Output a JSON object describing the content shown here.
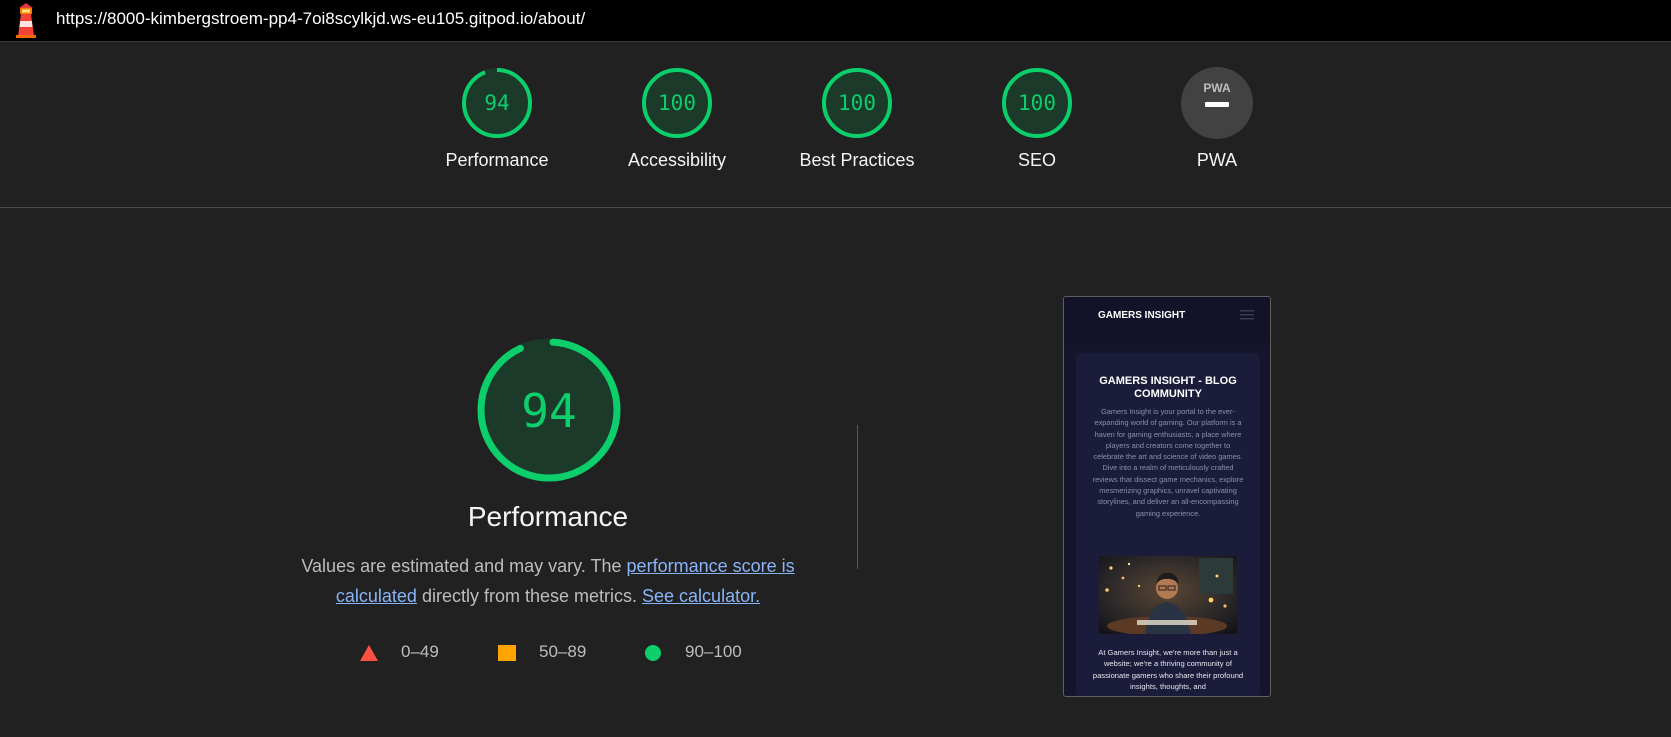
{
  "address_bar": {
    "icon": "lighthouse-icon",
    "url": "https://8000-kimbergstroem-pp4-7oi8scylkjd.ws-eu105.gitpod.io/about/"
  },
  "colors": {
    "pass": "#0cce6b",
    "pass_bg": "#1b3a2a",
    "average": "#ffa400",
    "fail": "#ff4e42",
    "pwa_bg": "#424242",
    "link": "#8ab4f8"
  },
  "gauges": [
    {
      "label": "Performance",
      "score": "94",
      "value": 94
    },
    {
      "label": "Accessibility",
      "score": "100",
      "value": 100
    },
    {
      "label": "Best Practices",
      "score": "100",
      "value": 100
    },
    {
      "label": "SEO",
      "score": "100",
      "value": 100
    },
    {
      "label": "PWA",
      "score": "",
      "badge": "PWA"
    }
  ],
  "performance": {
    "score": "94",
    "value": 94,
    "title": "Performance",
    "desc_prefix": "Values are estimated and may vary. The ",
    "desc_link1": "performance score is calculated",
    "desc_middle": " directly from these metrics. ",
    "desc_link2": "See calculator."
  },
  "legend": [
    {
      "shape": "triangle",
      "range": "0–49"
    },
    {
      "shape": "square",
      "range": "50–89"
    },
    {
      "shape": "circle",
      "range": "90–100"
    }
  ],
  "screenshot": {
    "brand": "GAMERS INSIGHT",
    "title": "GAMERS INSIGHT - BLOG COMMUNITY",
    "body": "Gamers Insight is your portal to the ever-expanding world of gaming. Our platform is a haven for gaming enthusiasts, a place where players and creators come together to celebrate the art and science of video games. Dive into a realm of meticulously crafted reviews that dissect game mechanics, explore mesmerizing graphics, unravel captivating storylines, and deliver an all-encompassing gaming experience.",
    "footer": "At Gamers Insight, we're more than just a website; we're a thriving community of passionate gamers who share their profound insights, thoughts, and"
  }
}
